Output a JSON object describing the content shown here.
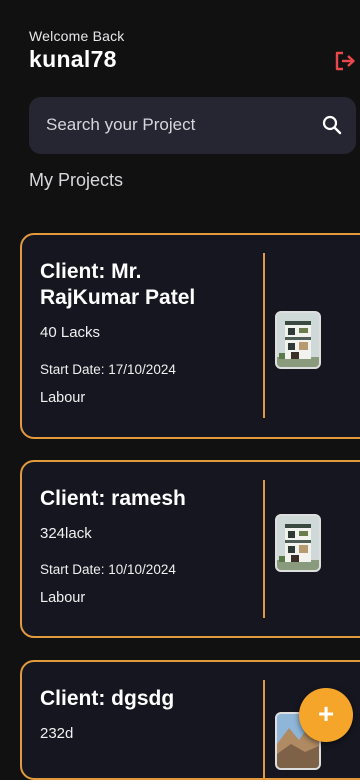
{
  "header": {
    "welcome": "Welcome Back",
    "username": "kunal78",
    "logout_icon": "logout-icon"
  },
  "search": {
    "placeholder": "Search your Project",
    "icon": "search-icon"
  },
  "section_title": "My Projects",
  "projects": [
    {
      "client": "Client: Mr. RajKumar Patel",
      "budget": "40 Lacks",
      "start_date": "Start Date: 17/10/2024",
      "role": "Labour",
      "thumbnail": "house-image"
    },
    {
      "client": "Client: ramesh",
      "budget": "324lack",
      "start_date": "Start Date: 10/10/2024",
      "role": "Labour",
      "thumbnail": "house-image"
    },
    {
      "client": "Client: dgsdg",
      "budget": "232d",
      "thumbnail": "landscape-image"
    }
  ],
  "fab": {
    "label": "+",
    "icon": "plus-icon"
  },
  "colors": {
    "background": "#111112",
    "accent": "#e29a3c",
    "fab": "#f5a52a",
    "logout": "#e8484a",
    "search_bg": "#262633"
  }
}
